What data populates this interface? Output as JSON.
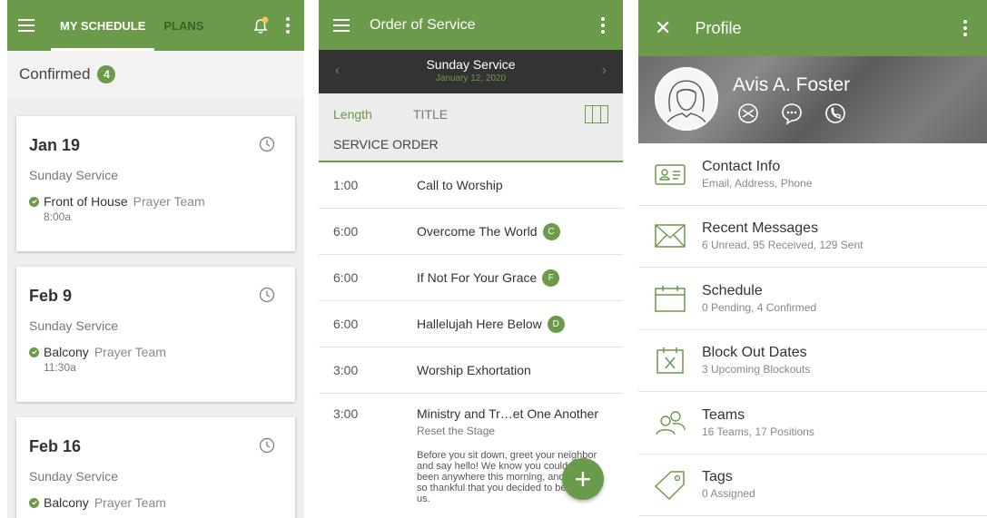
{
  "schedule": {
    "tabs": [
      "MY SCHEDULE",
      "PLANS"
    ],
    "confirmed_label": "Confirmed",
    "confirmed_count": "4",
    "cards": [
      {
        "date": "Jan 19",
        "service": "Sunday Service",
        "position": "Front of House",
        "team": "Prayer Team",
        "time": "8:00a"
      },
      {
        "date": "Feb 9",
        "service": "Sunday Service",
        "position": "Balcony",
        "team": "Prayer Team",
        "time": "11:30a"
      },
      {
        "date": "Feb 16",
        "service": "Sunday Service",
        "position": "Balcony",
        "team": "Prayer Team",
        "time": ""
      }
    ],
    "colors": {
      "accent": "#6a9a4a",
      "notification": "#f2c94c"
    }
  },
  "order": {
    "title": "Order of Service",
    "service_title": "Sunday Service",
    "service_date": "January 12, 2020",
    "col_length": "Length",
    "col_title": "TITLE",
    "section": "SERVICE ORDER",
    "rows": [
      {
        "length": "1:00",
        "title": "Call to Worship",
        "key": ""
      },
      {
        "length": "6:00",
        "title": "Overcome The World",
        "key": "C"
      },
      {
        "length": "6:00",
        "title": "If Not For Your Grace",
        "key": "F"
      },
      {
        "length": "6:00",
        "title": "Hallelujah Here Below",
        "key": "D"
      },
      {
        "length": "3:00",
        "title": "Worship Exhortation",
        "key": ""
      }
    ],
    "last_row": {
      "length": "3:00",
      "title": "Ministry and Tr…et One Another",
      "subtitle": "Reset the Stage",
      "description": "Before you sit down, greet your neighbor and say hello! We know you could have been anywhere this morning, and we are so thankful that you decided to be with us."
    },
    "fab": "+"
  },
  "profile": {
    "title": "Profile",
    "name": "Avis A. Foster",
    "items": [
      {
        "icon": "contact-card-icon",
        "title": "Contact Info",
        "sub": "Email, Address, Phone"
      },
      {
        "icon": "envelope-icon",
        "title": "Recent Messages",
        "sub": "6 Unread, 95 Received, 129 Sent"
      },
      {
        "icon": "calendar-icon",
        "title": "Schedule",
        "sub": "0 Pending, 4 Confirmed"
      },
      {
        "icon": "calendar-x-icon",
        "title": "Block Out Dates",
        "sub": "3 Upcoming Blockouts"
      },
      {
        "icon": "people-icon",
        "title": "Teams",
        "sub": "16 Teams, 17 Positions"
      },
      {
        "icon": "tag-icon",
        "title": "Tags",
        "sub": "0 Assigned"
      }
    ]
  }
}
